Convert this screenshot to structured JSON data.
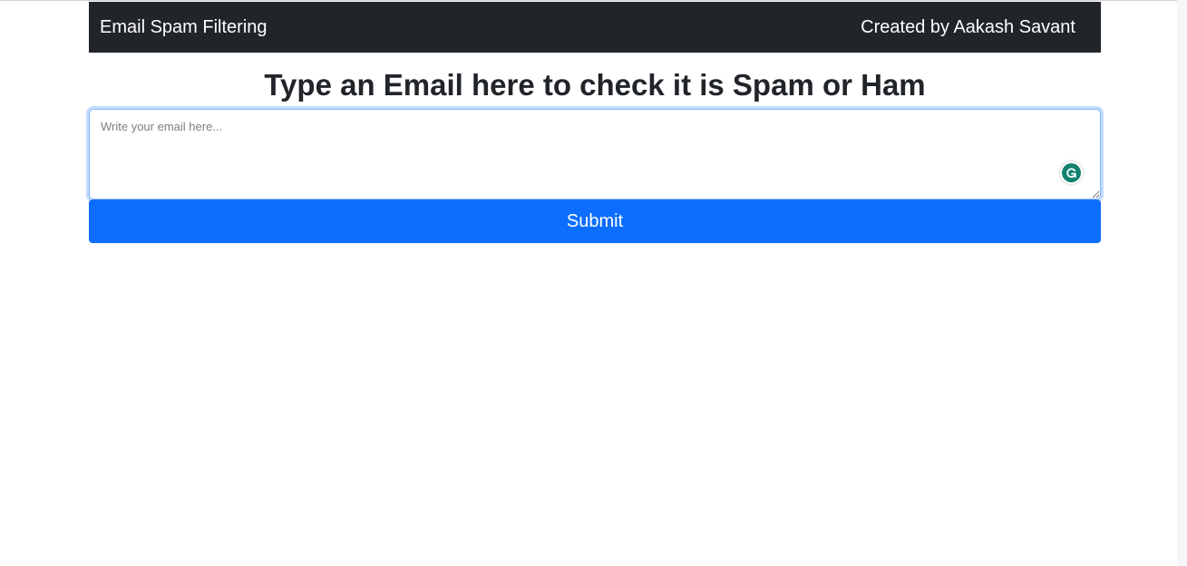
{
  "navbar": {
    "brand": "Email Spam Filtering",
    "credit": "Created by Aakash Savant"
  },
  "main": {
    "heading": "Type an Email here to check it is Spam or Ham",
    "email_input": {
      "placeholder": "Write your email here...",
      "value": ""
    },
    "submit_label": "Submit"
  },
  "icons": {
    "grammarly": "grammarly-icon"
  },
  "colors": {
    "navbar_bg": "#212529",
    "primary": "#0d6efd",
    "grammarly": "#11826e"
  }
}
